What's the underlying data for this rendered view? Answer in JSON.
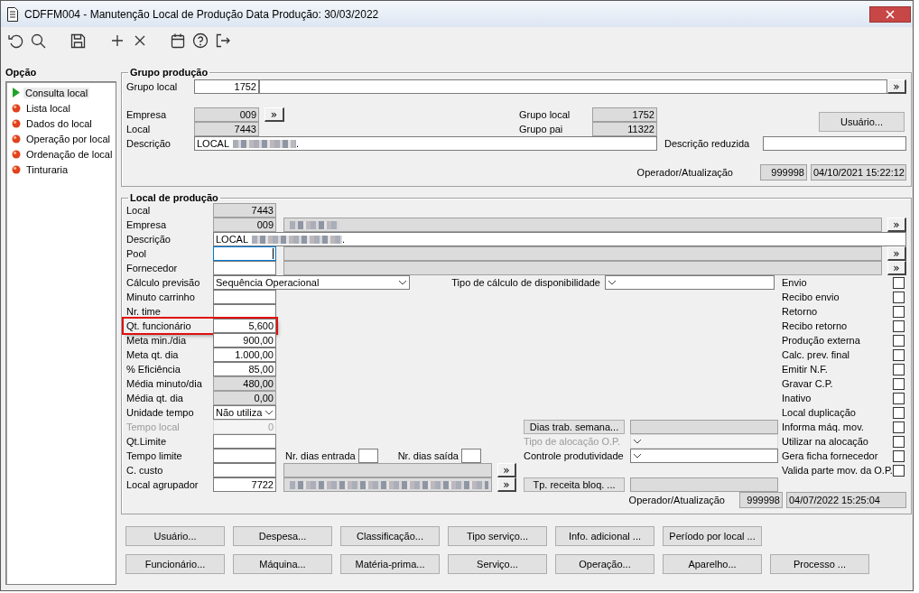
{
  "window": {
    "title": "CDFFM004 - Manutenção Local de Produção Data Produção: 30/03/2022"
  },
  "sidebar": {
    "title": "Opção",
    "items": [
      {
        "label": "Consulta local",
        "selected": true
      },
      {
        "label": "Lista local",
        "selected": false
      },
      {
        "label": "Dados do local",
        "selected": false
      },
      {
        "label": "Operação por local",
        "selected": false
      },
      {
        "label": "Ordenação de local",
        "selected": false
      },
      {
        "label": "Tinturaria",
        "selected": false
      }
    ]
  },
  "grupo_producao": {
    "title": "Grupo produção",
    "grupo_local": {
      "label": "Grupo local",
      "value": "1752",
      "lookup_button": "»"
    },
    "empresa": {
      "label": "Empresa",
      "value": "009",
      "lookup_button": "»"
    },
    "local": {
      "label": "Local",
      "value": "7443"
    },
    "descricao": {
      "label": "Descrição",
      "value": "LOCAL",
      "redacted": true,
      "value_end": "."
    },
    "grupo_local_right": {
      "label": "Grupo local",
      "value": "1752"
    },
    "grupo_pai": {
      "label": "Grupo pai",
      "value": "11322"
    },
    "descricao_reduzida": {
      "label": "Descrição reduzida"
    },
    "usuario_button": "Usuário...",
    "operador": {
      "label": "Operador/Atualização",
      "operator": "999998",
      "timestamp": "04/10/2021 15:22:12"
    }
  },
  "local_producao": {
    "title": "Local de produção",
    "top_rows": [
      {
        "label": "Local",
        "kind": "readonly",
        "value": "7443",
        "focused": false
      },
      {
        "label": "Empresa",
        "kind": "readonly",
        "value": "009",
        "focused": false,
        "detail": {
          "kind": "readonly",
          "redacted": true
        },
        "lookup_button": "»"
      },
      {
        "label": "Descrição",
        "kind": "wide_input",
        "value": "LOCAL",
        "redacted": true,
        "value_end": ".",
        "focused": false
      },
      {
        "label": "Pool",
        "kind": "input",
        "focused": true,
        "detail": {
          "kind": "readonly",
          "redacted": false
        },
        "lookup_button": "»"
      },
      {
        "label": "Fornecedor",
        "kind": "input",
        "focused": false,
        "detail": {
          "kind": "readonly",
          "redacted": false
        },
        "lookup_button": "»"
      }
    ],
    "rows": [
      {
        "label": "Cálculo previsão",
        "kind": "select",
        "value": "Sequência Operacional",
        "highlighted": false,
        "side": {
          "label": "Tipo de cálculo de disponibilidade",
          "kind": "select"
        }
      },
      {
        "label": "Minuto carrinho",
        "kind": "input",
        "highlighted": false
      },
      {
        "label": "Nr. time",
        "kind": "input",
        "highlighted": false
      },
      {
        "label": "Qt. funcionário",
        "kind": "input",
        "value": "5,600",
        "highlighted": true
      },
      {
        "label": "Meta min./dia",
        "kind": "input",
        "value": "900,00",
        "highlighted": false
      },
      {
        "label": "Meta qt. dia",
        "kind": "input",
        "value": "1.000,00",
        "highlighted": false
      },
      {
        "label": "% Eficiência",
        "kind": "input",
        "value": "85,00",
        "highlighted": false
      },
      {
        "label": "Média minuto/dia",
        "kind": "readonly",
        "value": "480,00",
        "highlighted": false
      },
      {
        "label": "Média qt. dia",
        "kind": "readonly",
        "value": "0,00",
        "highlighted": false
      },
      {
        "label": "Unidade tempo",
        "kind": "select",
        "value": "Não utiliza",
        "highlighted": false
      },
      {
        "label": "Tempo local",
        "kind": "disabled",
        "value": "0",
        "highlighted": false,
        "middle": {
          "kind": "button_field",
          "button": "Dias trab. semana..."
        }
      },
      {
        "label": "Qt.Limite",
        "kind": "input",
        "highlighted": false,
        "middle": {
          "kind": "select_field",
          "label": "Tipo de alocação O.P.",
          "disabled": true
        }
      },
      {
        "label": "Tempo limite",
        "kind": "input",
        "highlighted": false,
        "extras": [
          {
            "label": "Nr. dias entrada"
          },
          {
            "label": "Nr. dias saída"
          }
        ],
        "middle": {
          "kind": "select_field",
          "label": "Controle produtividade",
          "disabled": false
        }
      },
      {
        "label": "C. custo",
        "kind": "input",
        "highlighted": false,
        "detail": {
          "kind": "readonly",
          "redacted": false
        },
        "lookup_button": "»"
      },
      {
        "label": "Local agrupador",
        "kind": "input",
        "value": "7722",
        "highlighted": false,
        "detail": {
          "kind": "readonly",
          "redacted": true
        },
        "lookup_button": "»",
        "middle": {
          "kind": "button_field",
          "button": "Tp. receita bloq. ..."
        }
      }
    ],
    "checkboxes": [
      {
        "label": "Envio",
        "checked": false
      },
      {
        "label": "Recibo envio",
        "checked": false
      },
      {
        "label": "Retorno",
        "checked": false
      },
      {
        "label": "Recibo retorno",
        "checked": false
      },
      {
        "label": "Produção externa",
        "checked": false
      },
      {
        "label": "Calc. prev. final",
        "checked": false
      },
      {
        "label": "Emitir N.F.",
        "checked": false
      },
      {
        "label": "Gravar C.P.",
        "checked": false
      },
      {
        "label": "Inativo",
        "checked": false
      },
      {
        "label": "Local duplicação",
        "checked": false
      },
      {
        "label": "Informa máq. mov.",
        "checked": false
      },
      {
        "label": "Utilizar na alocação",
        "checked": false
      },
      {
        "label": "Gera ficha fornecedor",
        "checked": false
      },
      {
        "label": "Valida parte mov. da O.P.",
        "checked": false
      }
    ],
    "operador": {
      "label": "Operador/Atualização",
      "operator": "999998",
      "timestamp": "04/07/2022 15:25:04"
    }
  },
  "buttons": [
    [
      "Usuário...",
      "Despesa...",
      "Classificação...",
      "Tipo serviço...",
      "Info. adicional ...",
      "Período por local ..."
    ],
    [
      "Funcionário...",
      "Máquina...",
      "Matéria-prima...",
      "Serviço...",
      "Operação...",
      "Aparelho...",
      "Processo ..."
    ]
  ]
}
